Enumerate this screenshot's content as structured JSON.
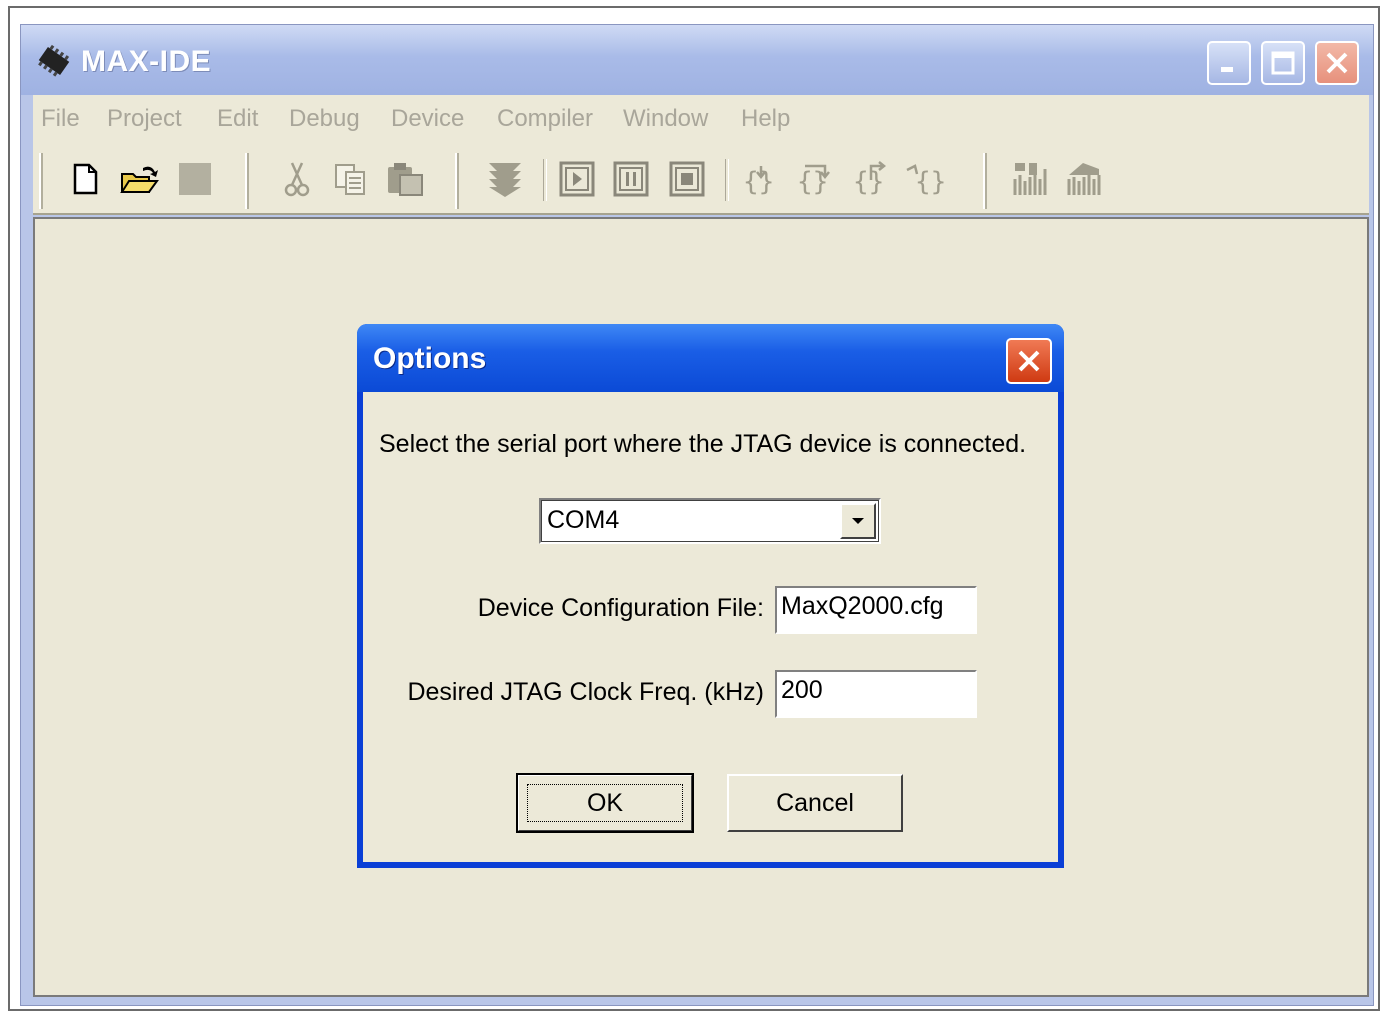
{
  "window": {
    "title": "MAX-IDE",
    "menu": [
      "File",
      "Project",
      "Edit",
      "Debug",
      "Device",
      "Compiler",
      "Window",
      "Help"
    ],
    "toolbar_icons": [
      "new-file-icon",
      "open-folder-icon",
      "save-icon",
      "cut-icon",
      "copy-icon",
      "paste-icon",
      "load-icon",
      "run-icon",
      "pause-icon",
      "stop-icon",
      "step-into-icon",
      "step-over-icon",
      "step-out-icon",
      "run-to-cursor-icon",
      "connect-icon",
      "disconnect-icon"
    ],
    "title_buttons": [
      "minimize",
      "maximize",
      "close"
    ]
  },
  "dialog": {
    "title": "Options",
    "prompt": "Select the serial port where the JTAG device is connected.",
    "port": {
      "selected": "COM4"
    },
    "config_file": {
      "label": "Device Configuration File:",
      "value": "MaxQ2000.cfg"
    },
    "clock_freq": {
      "label": "Desired JTAG Clock Freq. (kHz)",
      "value": "200"
    },
    "ok_label": "OK",
    "cancel_label": "Cancel"
  },
  "colors": {
    "dialog_title": "#0b4ad6",
    "client_bg": "#ebe8d7",
    "window_title_inactive": "#a9bbe8"
  }
}
